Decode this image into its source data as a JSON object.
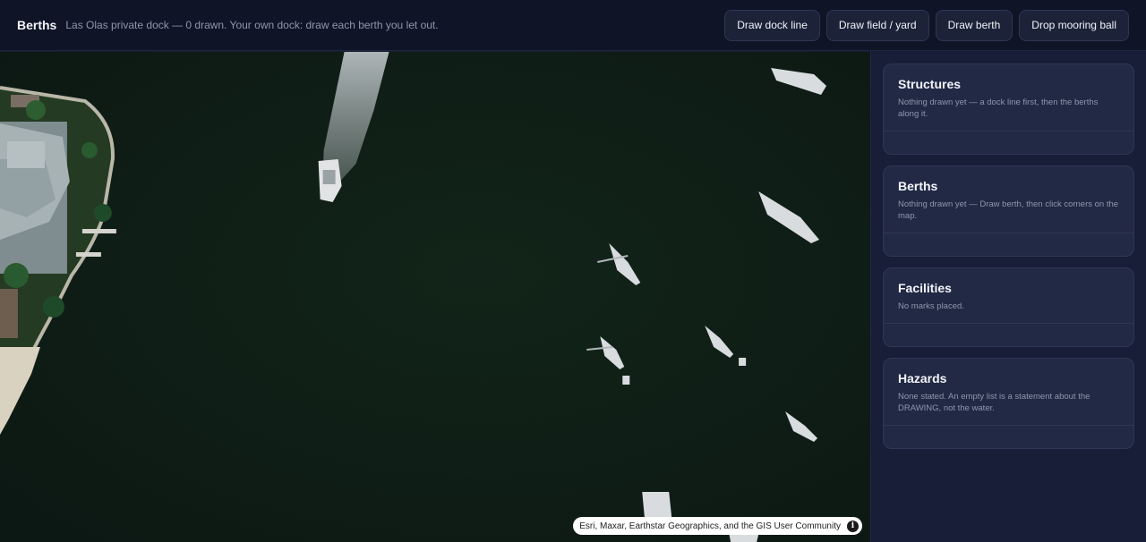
{
  "header": {
    "title": "Berths",
    "status": "Las Olas private dock — 0 drawn. Your own dock: draw each berth you let out."
  },
  "toolbar": {
    "draw_dock_line": "Draw dock line",
    "draw_field_yard": "Draw field / yard",
    "draw_berth": "Draw berth",
    "drop_mooring_ball": "Drop mooring ball"
  },
  "map": {
    "attribution": "Esri, Maxar, Earthstar Geographics, and the GIS User Community",
    "info_icon": "info-icon",
    "water_color": "#0f1f19"
  },
  "panel": {
    "structures": {
      "title": "Structures",
      "desc": "Nothing drawn yet — a dock line first, then the berths along it."
    },
    "berths": {
      "title": "Berths",
      "desc": "Nothing drawn yet — Draw berth, then click corners on the map."
    },
    "facilities": {
      "title": "Facilities",
      "desc": "No marks placed."
    },
    "hazards": {
      "title": "Hazards",
      "desc": "None stated. An empty list is a statement about the DRAWING, not the water."
    }
  }
}
